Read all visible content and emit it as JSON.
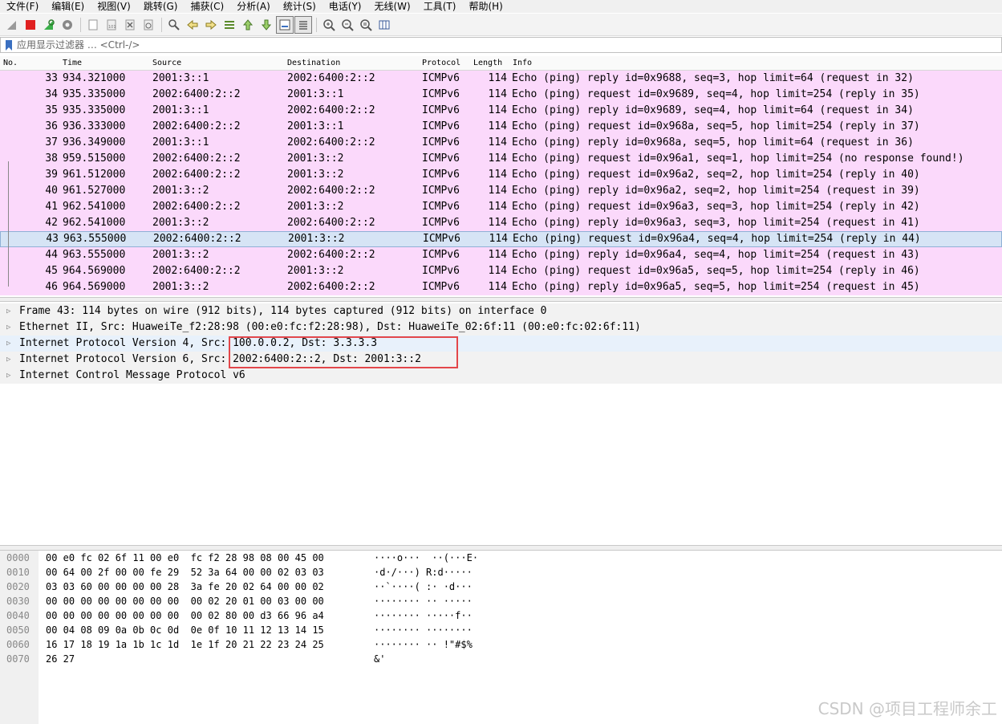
{
  "menubar": [
    "文件(F)",
    "编辑(E)",
    "视图(V)",
    "跳转(G)",
    "捕获(C)",
    "分析(A)",
    "统计(S)",
    "电话(Y)",
    "无线(W)",
    "工具(T)",
    "帮助(H)"
  ],
  "toolbar": {
    "icons": [
      "shark-fin-icon",
      "stop-icon",
      "restart-icon",
      "options-gear-icon",
      "open-file-icon",
      "save-file-icon",
      "close-file-icon",
      "reload-icon",
      "find-icon",
      "go-back-icon",
      "go-forward-icon",
      "go-to-packet-icon",
      "first-packet-icon",
      "last-packet-icon",
      "autoscroll-icon",
      "colorize-icon",
      "zoom-in-icon",
      "zoom-out-icon",
      "zoom-normal-icon",
      "resize-columns-icon"
    ]
  },
  "filter": {
    "placeholder": "应用显示过滤器 … <Ctrl-/>"
  },
  "packet_list": {
    "columns": [
      "No.",
      "Time",
      "Source",
      "Destination",
      "Protocol",
      "Length",
      "Info"
    ],
    "rows": [
      {
        "no": "33",
        "time": "934.321000",
        "src": "2001:3::1",
        "dst": "2002:6400:2::2",
        "proto": "ICMPv6",
        "len": "114",
        "info": "Echo (ping) reply id=0x9688, seq=3, hop limit=64 (request in 32)"
      },
      {
        "no": "34",
        "time": "935.335000",
        "src": "2002:6400:2::2",
        "dst": "2001:3::1",
        "proto": "ICMPv6",
        "len": "114",
        "info": "Echo (ping) request id=0x9689, seq=4, hop limit=254 (reply in 35)"
      },
      {
        "no": "35",
        "time": "935.335000",
        "src": "2001:3::1",
        "dst": "2002:6400:2::2",
        "proto": "ICMPv6",
        "len": "114",
        "info": "Echo (ping) reply id=0x9689, seq=4, hop limit=64 (request in 34)"
      },
      {
        "no": "36",
        "time": "936.333000",
        "src": "2002:6400:2::2",
        "dst": "2001:3::1",
        "proto": "ICMPv6",
        "len": "114",
        "info": "Echo (ping) request id=0x968a, seq=5, hop limit=254 (reply in 37)"
      },
      {
        "no": "37",
        "time": "936.349000",
        "src": "2001:3::1",
        "dst": "2002:6400:2::2",
        "proto": "ICMPv6",
        "len": "114",
        "info": "Echo (ping) reply id=0x968a, seq=5, hop limit=64 (request in 36)"
      },
      {
        "no": "38",
        "time": "959.515000",
        "src": "2002:6400:2::2",
        "dst": "2001:3::2",
        "proto": "ICMPv6",
        "len": "114",
        "info": "Echo (ping) request id=0x96a1, seq=1, hop limit=254 (no response found!)"
      },
      {
        "no": "39",
        "time": "961.512000",
        "src": "2002:6400:2::2",
        "dst": "2001:3::2",
        "proto": "ICMPv6",
        "len": "114",
        "info": "Echo (ping) request id=0x96a2, seq=2, hop limit=254 (reply in 40)"
      },
      {
        "no": "40",
        "time": "961.527000",
        "src": "2001:3::2",
        "dst": "2002:6400:2::2",
        "proto": "ICMPv6",
        "len": "114",
        "info": "Echo (ping) reply id=0x96a2, seq=2, hop limit=254 (request in 39)"
      },
      {
        "no": "41",
        "time": "962.541000",
        "src": "2002:6400:2::2",
        "dst": "2001:3::2",
        "proto": "ICMPv6",
        "len": "114",
        "info": "Echo (ping) request id=0x96a3, seq=3, hop limit=254 (reply in 42)"
      },
      {
        "no": "42",
        "time": "962.541000",
        "src": "2001:3::2",
        "dst": "2002:6400:2::2",
        "proto": "ICMPv6",
        "len": "114",
        "info": "Echo (ping) reply id=0x96a3, seq=3, hop limit=254 (request in 41)"
      },
      {
        "no": "43",
        "time": "963.555000",
        "src": "2002:6400:2::2",
        "dst": "2001:3::2",
        "proto": "ICMPv6",
        "len": "114",
        "info": "Echo (ping) request id=0x96a4, seq=4, hop limit=254 (reply in 44)"
      },
      {
        "no": "44",
        "time": "963.555000",
        "src": "2001:3::2",
        "dst": "2002:6400:2::2",
        "proto": "ICMPv6",
        "len": "114",
        "info": "Echo (ping) reply id=0x96a4, seq=4, hop limit=254 (request in 43)"
      },
      {
        "no": "45",
        "time": "964.569000",
        "src": "2002:6400:2::2",
        "dst": "2001:3::2",
        "proto": "ICMPv6",
        "len": "114",
        "info": "Echo (ping) request id=0x96a5, seq=5, hop limit=254 (reply in 46)"
      },
      {
        "no": "46",
        "time": "964.569000",
        "src": "2001:3::2",
        "dst": "2002:6400:2::2",
        "proto": "ICMPv6",
        "len": "114",
        "info": "Echo (ping) reply id=0x96a5, seq=5, hop limit=254 (request in 45)"
      }
    ],
    "selected_no": "43",
    "row_color": "#fbd9fb",
    "selected_color": "#d6e4f5"
  },
  "details": [
    {
      "text": "Frame 43: 114 bytes on wire (912 bits), 114 bytes captured (912 bits) on interface 0"
    },
    {
      "text": "Ethernet II, Src: HuaweiTe_f2:28:98 (00:e0:fc:f2:28:98), Dst: HuaweiTe_02:6f:11 (00:e0:fc:02:6f:11)"
    },
    {
      "text": "Internet Protocol Version 4, Src: 100.0.0.2, Dst: 3.3.3.3"
    },
    {
      "text": "Internet Protocol Version 6, Src: 2002:6400:2::2, Dst: 2001:3::2"
    },
    {
      "text": "Internet Control Message Protocol v6"
    }
  ],
  "annotation_color": "#e3474a",
  "bytes": [
    {
      "off": "0000",
      "hex": "00 e0 fc 02 6f 11 00 e0  fc f2 28 98 08 00 45 00",
      "asc": "····o···  ··(···E·"
    },
    {
      "off": "0010",
      "hex": "00 64 00 2f 00 00 fe 29  52 3a 64 00 00 02 03 03",
      "asc": "·d·/···) R:d·····"
    },
    {
      "off": "0020",
      "hex": "03 03 60 00 00 00 00 28  3a fe 20 02 64 00 00 02",
      "asc": "··`····( :· ·d···"
    },
    {
      "off": "0030",
      "hex": "00 00 00 00 00 00 00 00  00 02 20 01 00 03 00 00",
      "asc": "········ ·· ·····"
    },
    {
      "off": "0040",
      "hex": "00 00 00 00 00 00 00 00  00 02 80 00 d3 66 96 a4",
      "asc": "········ ·····f··"
    },
    {
      "off": "0050",
      "hex": "00 04 08 09 0a 0b 0c 0d  0e 0f 10 11 12 13 14 15",
      "asc": "········ ········"
    },
    {
      "off": "0060",
      "hex": "16 17 18 19 1a 1b 1c 1d  1e 1f 20 21 22 23 24 25",
      "asc": "········ ·· !\"#$%"
    },
    {
      "off": "0070",
      "hex": "26 27",
      "asc": "&'"
    }
  ],
  "watermark": "CSDN @项目工程师余工"
}
